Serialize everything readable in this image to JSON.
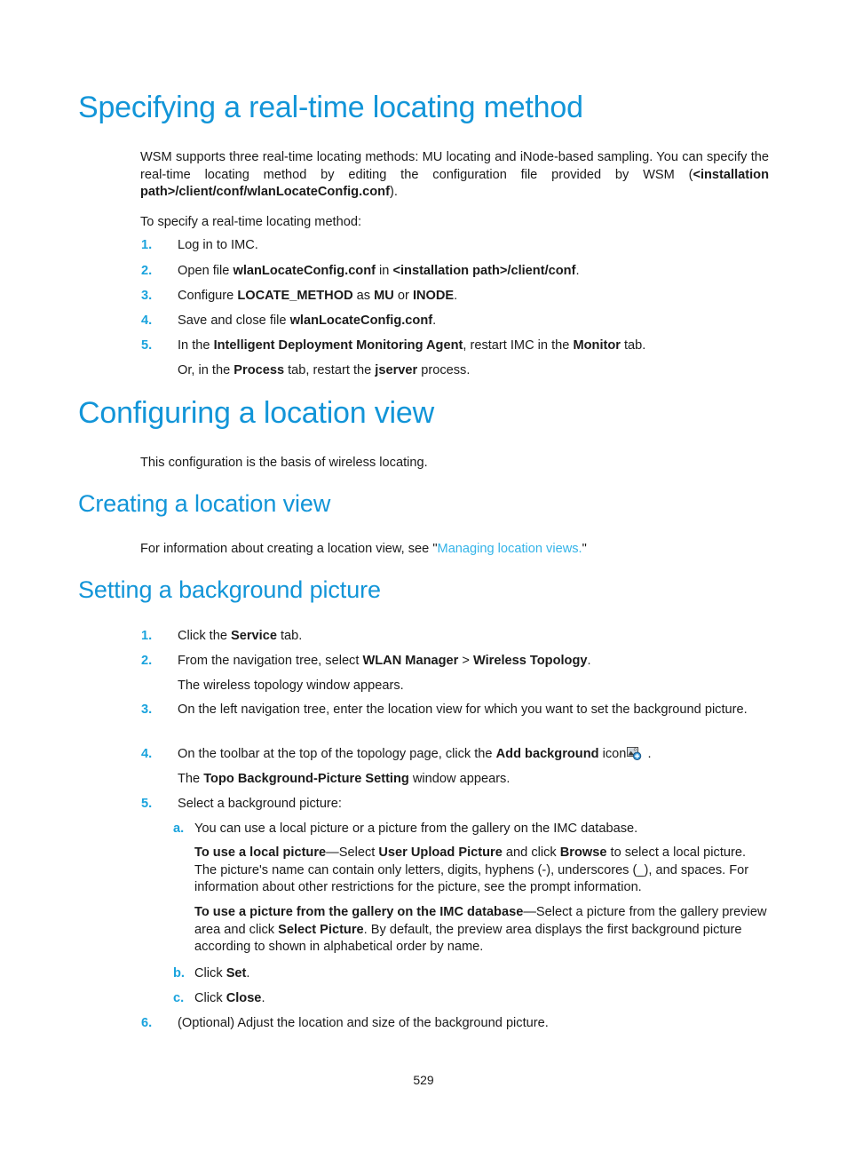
{
  "document": {
    "page_number": "529"
  },
  "sections": [
    {
      "id": "specifying-real-time-locating-method",
      "heading": "Specifying a real-time locating method",
      "intro_parts": {
        "p1_a": "WSM supports three real-time locating methods: MU locating and iNode-based sampling. You can specify the real-time locating method by editing the configuration file provided by WSM (",
        "p1_bold": "<installation path>/client/conf/wlanLocateConfig.conf",
        "p1_b": ")."
      },
      "lead_in": "To specify a real-time locating method:",
      "steps": [
        {
          "marker": "1.",
          "a": "Log in to IMC.",
          "bold1": "",
          "b": "",
          "bold2": "",
          "c": "",
          "bold3": "",
          "d": ""
        },
        {
          "marker": "2.",
          "a": "Open file ",
          "bold1": "wlanLocateConfig.conf",
          "b": " in ",
          "bold2": "<installation path>/client/conf",
          "c": ".",
          "bold3": "",
          "d": ""
        },
        {
          "marker": "3.",
          "a": "Configure ",
          "bold1": "LOCATE_METHOD",
          "b": " as ",
          "bold2": "MU",
          "c": " or ",
          "bold3": "INODE",
          "d": "."
        },
        {
          "marker": "4.",
          "a": "Save and close file ",
          "bold1": "wlanLocateConfig.conf",
          "b": ".",
          "bold2": "",
          "c": "",
          "bold3": "",
          "d": ""
        },
        {
          "marker": "5.",
          "a": "In the ",
          "bold1": "Intelligent Deployment Monitoring Agent",
          "b": ", restart IMC in the ",
          "bold2": "Monitor",
          "c": " tab.",
          "bold3": "",
          "d": ""
        }
      ],
      "step5_continuation": {
        "a": "Or, in the ",
        "bold1": "Process",
        "b": " tab, restart the ",
        "bold2": "jserver",
        "c": " process."
      }
    },
    {
      "id": "configuring-a-location-view",
      "heading": "Configuring a location view",
      "body": "This configuration is the basis of wireless locating."
    },
    {
      "id": "creating-a-location-view",
      "heading": "Creating a location view",
      "body_a": "For information about creating a location view, see \"",
      "body_link": "Managing location views.",
      "body_b": "\""
    },
    {
      "id": "setting-a-background-picture",
      "heading": "Setting a background picture",
      "steps": [
        {
          "marker": "1.",
          "a": "Click the ",
          "bold1": "Service",
          "b": " tab.",
          "bold2": "",
          "c": ""
        },
        {
          "marker": "2.",
          "a": "From the navigation tree, select ",
          "bold1": "WLAN Manager",
          "b": " > ",
          "bold2": "Wireless Topology",
          "c": ".",
          "continuation": "The wireless topology window appears."
        },
        {
          "marker": "3.",
          "a": "On the left navigation tree, enter the location view for which you want to set the background picture.",
          "bold1": "",
          "b": "",
          "bold2": "",
          "c": ""
        },
        {
          "marker": "4.",
          "a": "On the toolbar at the top of the topology page, click the ",
          "bold1": "Add background",
          "b": " icon",
          "icon": "add-background-icon",
          "c": " .",
          "continuation_a": "The ",
          "continuation_bold": "Topo Background-Picture Setting",
          "continuation_b": " window appears."
        },
        {
          "marker": "5.",
          "a": "Select a background picture:",
          "bold1": "",
          "b": "",
          "bold2": "",
          "c": ""
        },
        {
          "marker": "6.",
          "a": "(Optional) Adjust the location and size of the background picture.",
          "bold1": "",
          "b": "",
          "bold2": "",
          "c": ""
        }
      ],
      "substeps": [
        {
          "marker": "a.",
          "text": "You can use a local picture or a picture from the gallery on the IMC database."
        },
        {
          "marker": "b.",
          "a": "Click ",
          "bold1": "Set",
          "b": "."
        },
        {
          "marker": "c.",
          "a": "Click ",
          "bold1": "Close",
          "b": "."
        }
      ],
      "local_picture_para": {
        "bold_lead": "To use a local picture",
        "a": "—Select ",
        "bold1": "User Upload Picture",
        "b": " and click ",
        "bold2": "Browse",
        "c": " to select a local picture. The picture's name can contain only letters, digits, hyphens (-), underscores (_), and spaces. For information about other restrictions for the picture, see the prompt information."
      },
      "gallery_picture_para": {
        "bold_lead": "To use a picture from the gallery on the IMC database",
        "a": "—Select a picture from the gallery preview area and click ",
        "bold1": "Select Picture",
        "b": ". By default, the preview area displays the first background picture according to shown in alphabetical order by name."
      }
    }
  ],
  "colors": {
    "heading_blue": "#1295d8",
    "marker_blue": "#1aa3dd",
    "link_blue": "#33b3e8",
    "body_text": "#1a1a1a"
  }
}
